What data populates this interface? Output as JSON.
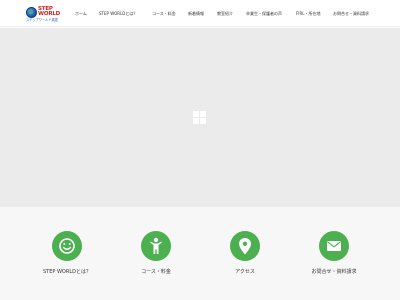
{
  "logo": {
    "line1": "STEP",
    "line2": "WORLD",
    "subtitle": "ステップワールド英語"
  },
  "nav": [
    {
      "label": "ホーム"
    },
    {
      "label": "STEP WORLDとは？"
    },
    {
      "label": "コース・料金"
    },
    {
      "label": "新着情報"
    },
    {
      "label": "教室紹介"
    },
    {
      "label": "卒業生・保護者の声"
    },
    {
      "label": "FIRL・所在地"
    },
    {
      "label": "お問合せ・資料請求"
    }
  ],
  "hero": {
    "loader_icon": "loading-squares-icon"
  },
  "features": [
    {
      "label": "STEP WORLDとは？",
      "icon": "smiley-icon"
    },
    {
      "label": "コース・料金",
      "icon": "child-icon"
    },
    {
      "label": "アクセス",
      "icon": "map-pin-icon"
    },
    {
      "label": "お問合せ・資料請求",
      "icon": "envelope-icon"
    }
  ],
  "colors": {
    "accent_green": "#4caf50",
    "logo_red": "#d62020",
    "logo_blue": "#1e5fb8",
    "hero_bg": "#ebebeb",
    "features_bg": "#f7f7f7"
  }
}
